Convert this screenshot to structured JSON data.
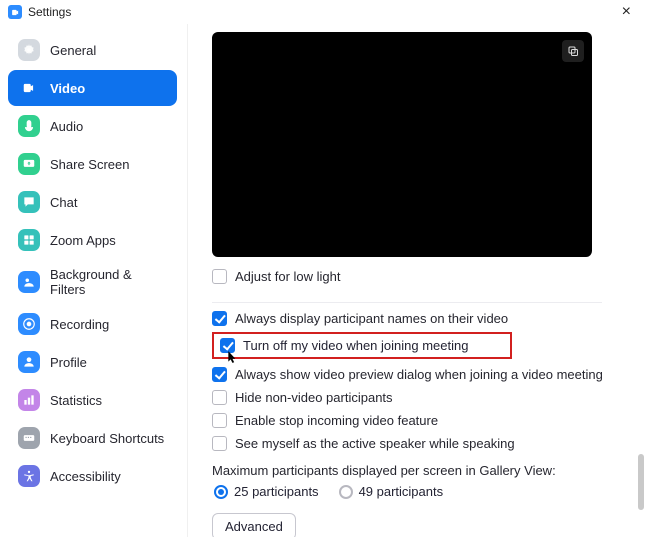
{
  "window": {
    "title": "Settings"
  },
  "sidebar": {
    "items": [
      {
        "label": "General",
        "icon": "gear-icon",
        "color": "#d4d9df",
        "active": false
      },
      {
        "label": "Video",
        "icon": "video-icon",
        "color": "#ffffff",
        "active": true
      },
      {
        "label": "Audio",
        "icon": "audio-icon",
        "color": "#31d08f",
        "active": false
      },
      {
        "label": "Share Screen",
        "icon": "share-icon",
        "color": "#31d08f",
        "active": false
      },
      {
        "label": "Chat",
        "icon": "chat-icon",
        "color": "#35c1ba",
        "active": false
      },
      {
        "label": "Zoom Apps",
        "icon": "apps-icon",
        "color": "#35c1ba",
        "active": false
      },
      {
        "label": "Background & Filters",
        "icon": "background-icon",
        "color": "#2d8cff",
        "active": false
      },
      {
        "label": "Recording",
        "icon": "recording-icon",
        "color": "#2d8cff",
        "active": false
      },
      {
        "label": "Profile",
        "icon": "profile-icon",
        "color": "#2d8cff",
        "active": false
      },
      {
        "label": "Statistics",
        "icon": "statistics-icon",
        "color": "#c385e8",
        "active": false
      },
      {
        "label": "Keyboard Shortcuts",
        "icon": "keyboard-icon",
        "color": "#9ea4ad",
        "active": false
      },
      {
        "label": "Accessibility",
        "icon": "accessibility-icon",
        "color": "#6b74e4",
        "active": false
      }
    ]
  },
  "video": {
    "adjust_low_light": {
      "label": "Adjust for low light",
      "checked": false
    },
    "checks": [
      {
        "label": "Always display participant names on their video",
        "checked": true,
        "highlighted": false
      },
      {
        "label": "Turn off my video when joining meeting",
        "checked": true,
        "highlighted": true
      },
      {
        "label": "Always show video preview dialog when joining a video meeting",
        "checked": true,
        "highlighted": false
      },
      {
        "label": "Hide non-video participants",
        "checked": false,
        "highlighted": false
      },
      {
        "label": "Enable stop incoming video feature",
        "checked": false,
        "highlighted": false
      },
      {
        "label": "See myself as the active speaker while speaking",
        "checked": false,
        "highlighted": false
      }
    ],
    "gallery_label": "Maximum participants displayed per screen in Gallery View:",
    "gallery_options": [
      {
        "label": "25 participants",
        "selected": true
      },
      {
        "label": "49 participants",
        "selected": false
      }
    ],
    "advanced_button": "Advanced"
  }
}
